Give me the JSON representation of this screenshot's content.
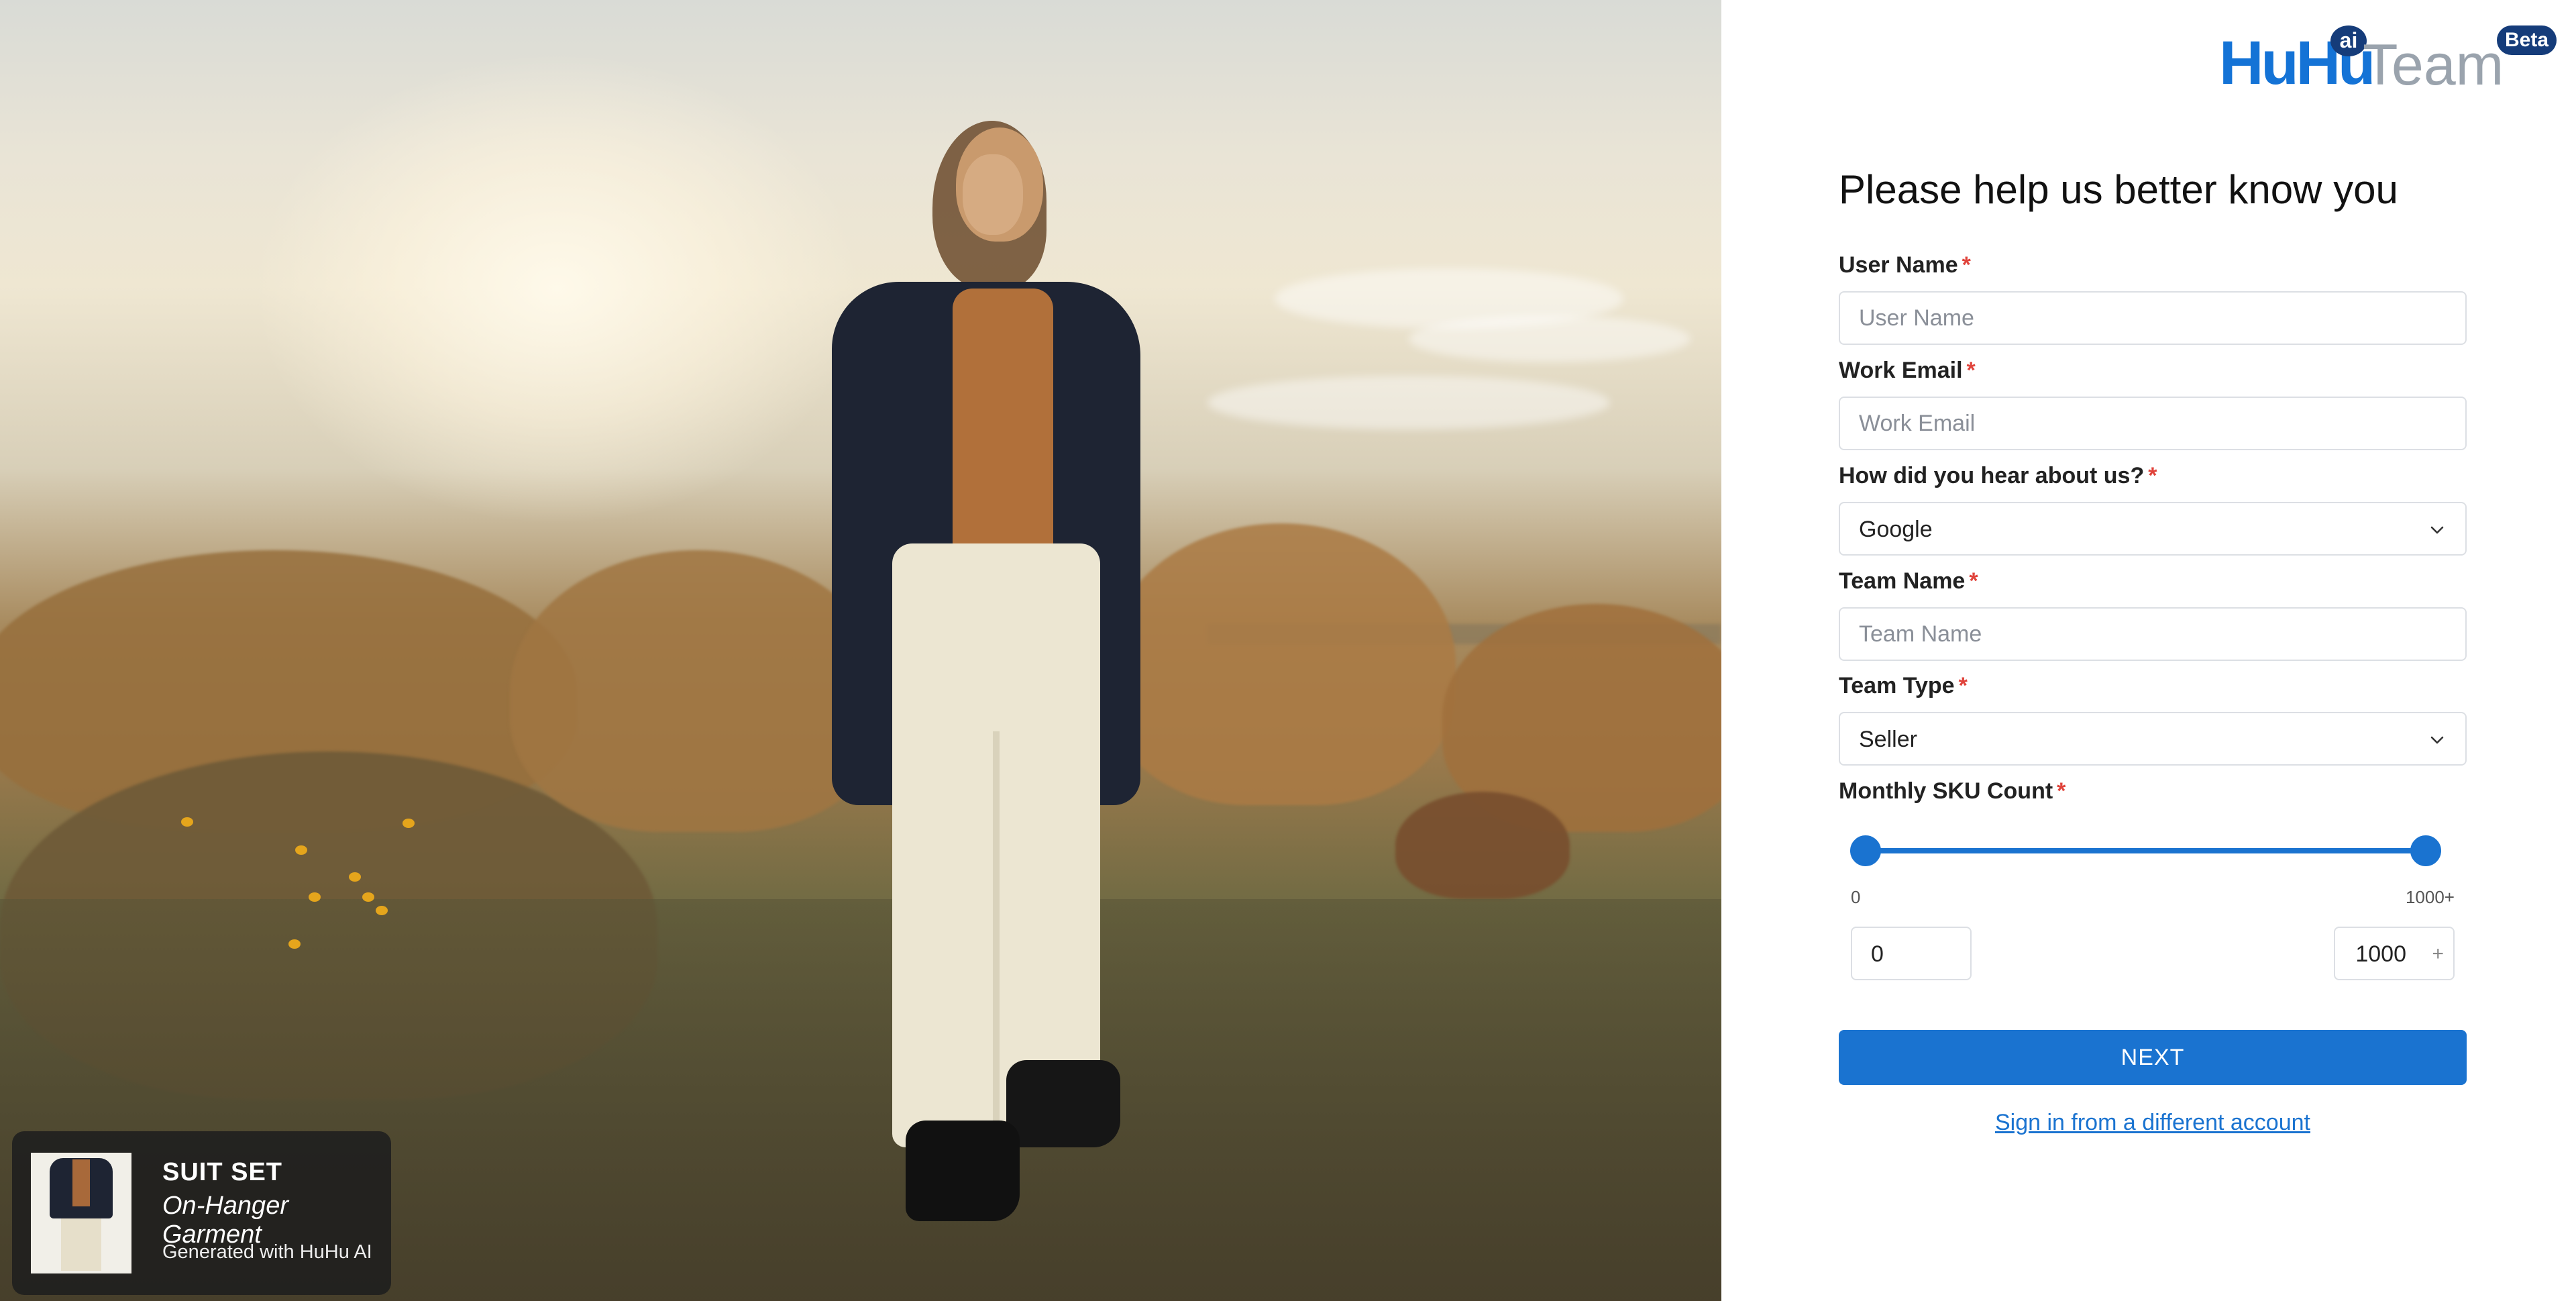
{
  "hero": {
    "caption": {
      "title": "SUIT SET",
      "subtitle": "On-Hanger Garment",
      "generated": "Generated with HuHu AI"
    }
  },
  "brand": {
    "name_main": "HuHu",
    "ai_badge": "ai",
    "name_suffix": "Team",
    "beta_badge": "Beta",
    "primary_color": "#1a73d0",
    "dark_color": "#153c7a"
  },
  "form": {
    "heading": "Please help us better know you",
    "required_mark": "*",
    "user_name": {
      "label": "User Name",
      "placeholder": "User Name",
      "value": ""
    },
    "work_email": {
      "label": "Work Email",
      "placeholder": "Work Email",
      "value": ""
    },
    "hear_about": {
      "label": "How did you hear about us?",
      "selected": "Google"
    },
    "team_name": {
      "label": "Team Name",
      "placeholder": "Team Name",
      "value": ""
    },
    "team_type": {
      "label": "Team Type",
      "selected": "Seller"
    },
    "sku": {
      "label": "Monthly SKU Count",
      "min_label": "0",
      "max_label": "1000+",
      "min_value": "0",
      "max_value": "1000",
      "range_fraction": [
        0,
        1
      ],
      "plus": "+"
    },
    "next_label": "NEXT",
    "alt_link": "Sign in from a different account"
  }
}
